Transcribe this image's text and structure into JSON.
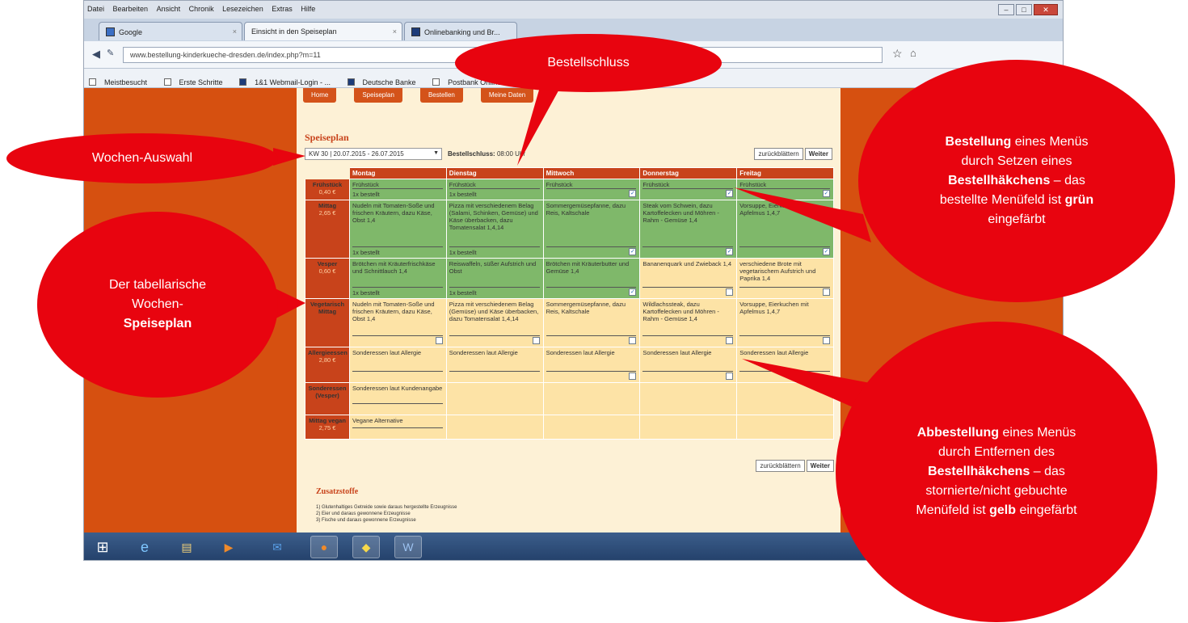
{
  "browser": {
    "menu": [
      "Datei",
      "Bearbeiten",
      "Ansicht",
      "Chronik",
      "Lesezeichen",
      "Extras",
      "Hilfe"
    ],
    "tabs": [
      {
        "label": "Google"
      },
      {
        "label": "Einsicht in den Speiseplan"
      },
      {
        "label": "Onlinebanking und Br..."
      }
    ],
    "url": "www.bestellung-kinderkueche-dresden.de/index.php?m=11",
    "bookmarks": [
      "Meistbesucht",
      "Erste Schritte",
      "1&1 Webmail-Login - ...",
      "Deutsche Banke",
      "Postbank Online-Banki..."
    ]
  },
  "page": {
    "nav": [
      "Home",
      "Speiseplan",
      "Bestellen",
      "Meine Daten"
    ],
    "title": "Speiseplan",
    "week_select": "KW 30 | 20.07.2015 - 26.07.2015",
    "schluss_label": "Bestellschluss:",
    "schluss_value": "08:00 Uhr",
    "back_label": "zurückblättern",
    "next_label": "Weiter",
    "days": [
      "Montag",
      "Dienstag",
      "Mittwoch",
      "Donnerstag",
      "Freitag"
    ],
    "rows": [
      {
        "label": "Frühstück",
        "price": "0,40 €",
        "cells": [
          {
            "dish": "Frühstück",
            "ordered": "1x bestellt",
            "state": "green"
          },
          {
            "dish": "Frühstück",
            "ordered": "1x bestellt",
            "state": "green"
          },
          {
            "dish": "Frühstück",
            "ordered": "",
            "state": "green",
            "checked": true
          },
          {
            "dish": "Frühstück",
            "ordered": "",
            "state": "green",
            "checked": true
          },
          {
            "dish": "Frühstück",
            "ordered": "",
            "state": "green",
            "checked": true
          }
        ]
      },
      {
        "label": "Mittag",
        "price": "2,65 €",
        "cells": [
          {
            "dish": "Nudeln mit Tomaten-Soße und frischen Kräutern, dazu Käse, Obst 1,4",
            "ordered": "1x bestellt",
            "state": "green"
          },
          {
            "dish": "Pizza mit verschiedenem Belag (Salami, Schinken, Gemüse) und Käse überbacken, dazu Tomatensalat 1,4,14",
            "ordered": "1x bestellt",
            "state": "green"
          },
          {
            "dish": "Sommergemüsepfanne, dazu Reis, Kaltschale",
            "ordered": "",
            "state": "green",
            "checked": true
          },
          {
            "dish": "Steak vom Schwein, dazu Kartoffelecken und Möhren - Rahm - Gemüse 1,4",
            "ordered": "",
            "state": "green",
            "checked": true
          },
          {
            "dish": "Vorsuppe, Eierkuchen mit Apfelmus 1,4,7",
            "ordered": "",
            "state": "green",
            "checked": true
          }
        ]
      },
      {
        "label": "Vesper",
        "price": "0,60 €",
        "cells": [
          {
            "dish": "Brötchen mit Kräuterfrischkäse und Schnittlauch 1,4",
            "ordered": "1x bestellt",
            "state": "green"
          },
          {
            "dish": "Reiswaffeln, süßer Aufstrich und Obst",
            "ordered": "1x bestellt",
            "state": "green"
          },
          {
            "dish": "Brötchen mit Kräuterbutter und Gemüse 1,4",
            "ordered": "",
            "state": "green",
            "checked": true
          },
          {
            "dish": "Bananenquark und Zwieback 1,4",
            "ordered": "",
            "state": "yellow",
            "checked": false
          },
          {
            "dish": "verschiedene Brote mit vegetarischem Aufstrich und Paprika 1,4",
            "ordered": "",
            "state": "yellow",
            "checked": false
          }
        ]
      },
      {
        "label": "Vegetarisch Mittag",
        "price": "",
        "cells": [
          {
            "dish": "Nudeln mit Tomaten-Soße und frischen Kräutern, dazu Käse, Obst 1,4",
            "ordered": "",
            "state": "yellow",
            "checked": false
          },
          {
            "dish": "Pizza mit verschiedenem Belag (Gemüse) und Käse überbacken, dazu Tomatensalat 1,4,14",
            "ordered": "",
            "state": "yellow",
            "checked": false
          },
          {
            "dish": "Sommergemüsepfanne, dazu Reis, Kaltschale",
            "ordered": "",
            "state": "yellow",
            "checked": false
          },
          {
            "dish": "Wildlachssteak, dazu Kartoffelecken und Möhren - Rahm - Gemüse 1,4",
            "ordered": "",
            "state": "yellow",
            "checked": false
          },
          {
            "dish": "Vorsuppe, Eierkuchen mit Apfelmus 1,4,7",
            "ordered": "",
            "state": "yellow",
            "checked": false
          }
        ]
      },
      {
        "label": "Allergieessen",
        "price": "2,80 €",
        "cells": [
          {
            "dish": "Sonderessen laut Allergie",
            "ordered": "",
            "state": "yellow"
          },
          {
            "dish": "Sonderessen laut Allergie",
            "ordered": "",
            "state": "yellow"
          },
          {
            "dish": "Sonderessen laut Allergie",
            "ordered": "",
            "state": "yellow",
            "checked": false
          },
          {
            "dish": "Sonderessen laut Allergie",
            "ordered": "",
            "state": "yellow",
            "checked": false
          },
          {
            "dish": "Sonderessen laut Allergie",
            "ordered": "",
            "state": "yellow"
          }
        ]
      },
      {
        "label": "Sonderessen (Vesper)",
        "price": "",
        "cells": [
          {
            "dish": "Sonderessen laut Kundenangabe",
            "ordered": "",
            "state": "yellow"
          },
          {
            "dish": "",
            "ordered": "",
            "state": "yellow"
          },
          {
            "dish": "",
            "ordered": "",
            "state": "yellow"
          },
          {
            "dish": "",
            "ordered": "",
            "state": "yellow"
          },
          {
            "dish": "",
            "ordered": "",
            "state": "yellow"
          }
        ]
      },
      {
        "label": "Mittag vegan",
        "price": "2,75 €",
        "cells": [
          {
            "dish": "Vegane Alternative",
            "ordered": "",
            "state": "yellow"
          },
          {
            "dish": "",
            "ordered": "",
            "state": "yellow"
          },
          {
            "dish": "",
            "ordered": "",
            "state": "yellow"
          },
          {
            "dish": "",
            "ordered": "",
            "state": "yellow"
          },
          {
            "dish": "",
            "ordered": "",
            "state": "yellow"
          }
        ]
      }
    ],
    "zusatz_title": "Zusatzstoffe",
    "zusatz_items": [
      "1) Glutenhaltiges Getreide sowie daraus hergestellte Erzeugnisse",
      "2) Eier und daraus gewonnene Erzeugnisse",
      "3) Fische und daraus gewonnene Erzeugnisse"
    ]
  },
  "callouts": {
    "bestellschluss": "Bestellschluss",
    "wochen_auswahl": "Wochen-Auswahl",
    "speiseplan_pre": "Der tabellarische Wochen-",
    "speiseplan_bold": "Speiseplan",
    "bestellung": {
      "b1": "Bestellung",
      "t1": " eines Menüs durch Setzen eines ",
      "b2": "Bestellhäkchens",
      "t2": " – das bestellte Menüfeld ist ",
      "b3": "grün",
      "t3": " eingefärbt"
    },
    "abbestellung": {
      "b1": "Abbestellung",
      "t1": " eines Menüs durch Entfernen des ",
      "b2": "Bestellhäkchens",
      "t2": " – das stornierte/nicht gebuchte Menüfeld ist ",
      "b3": "gelb",
      "t3": " eingefärbt"
    }
  },
  "colors": {
    "callout": "#e8040f",
    "page_orange": "#d65010",
    "header_red": "#c8431b",
    "ordered_green": "#7fb86a",
    "cancelled_yellow": "#fde3a6"
  }
}
